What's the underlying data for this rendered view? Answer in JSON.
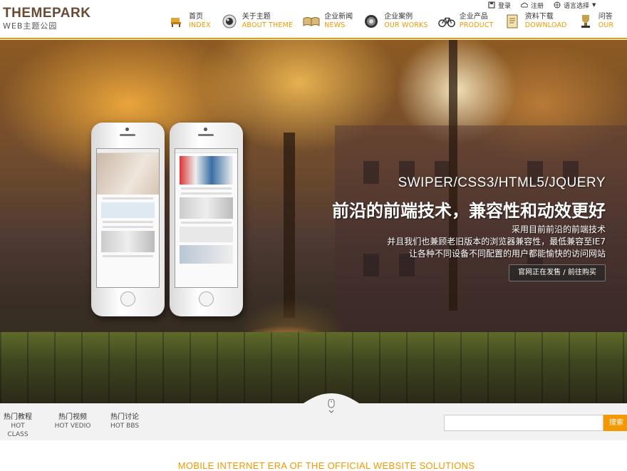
{
  "logo": {
    "main": "THEMEPARK",
    "sub": "WEB主题公园"
  },
  "topbar": {
    "login": "登录",
    "register": "注册",
    "language": "语言选择"
  },
  "nav": [
    {
      "cn": "首页",
      "en": "INDEX",
      "icon": "chair-icon"
    },
    {
      "cn": "关于主题",
      "en": "ABOUT THEME",
      "icon": "eye-icon"
    },
    {
      "cn": "企业新闻",
      "en": "NEWS",
      "icon": "book-icon"
    },
    {
      "cn": "企业案例",
      "en": "OUR WORKS",
      "icon": "badge-icon"
    },
    {
      "cn": "企业产品",
      "en": "PRODUCT",
      "icon": "bicycle-icon"
    },
    {
      "cn": "资料下载",
      "en": "DOWNLOAD",
      "icon": "document-icon"
    },
    {
      "cn": "问答",
      "en": "OUR",
      "icon": "trophy-icon"
    }
  ],
  "hero": {
    "headline_en": "SWIPER/CSS3/HTML5/JQUERY",
    "headline_cn": "前沿的前端技术，兼容性和动效更好",
    "lines": [
      "采用目前前沿的前端技术",
      "并且我们也兼顾老旧版本的浏览器兼容性，最低兼容至IE7",
      "让各种不同设备不同配置的用户都能愉快的访问网站"
    ],
    "button": "官网正在发售 / 前往购买"
  },
  "hot": [
    {
      "cn": "热门教程",
      "en": "HOT CLASS"
    },
    {
      "cn": "热门视频",
      "en": "HOT VEDIO"
    },
    {
      "cn": "热门讨论",
      "en": "HOT BBS"
    }
  ],
  "search": {
    "placeholder": "",
    "button": "搜索"
  },
  "section_title": "MOBILE INTERNET ERA OF THE OFFICIAL WEBSITE SOLUTIONS",
  "colors": {
    "accent": "#f39800",
    "logo": "#6b4a33"
  }
}
